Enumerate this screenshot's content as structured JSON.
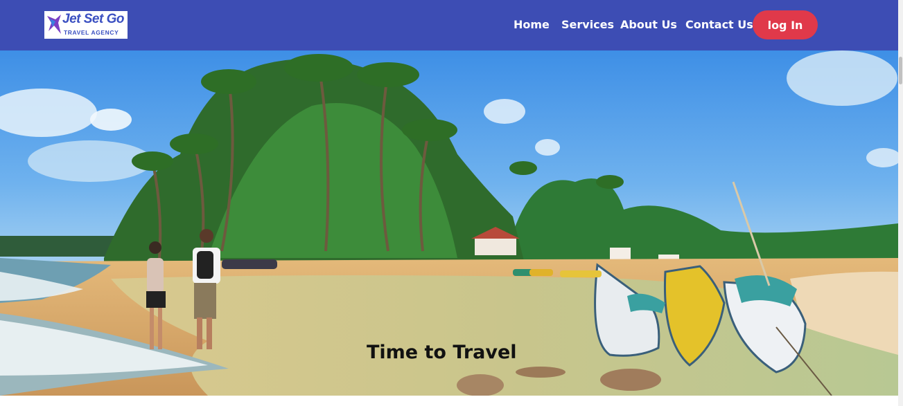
{
  "brand": {
    "name": "Jet Set Go",
    "tagline": "TRAVEL AGENCY"
  },
  "nav": {
    "links": [
      {
        "label": "Home"
      },
      {
        "label": "Services"
      },
      {
        "label": "About Us"
      },
      {
        "label": "Contact Us"
      }
    ],
    "login_label": "log In"
  },
  "hero": {
    "title": "Time to Travel",
    "image_icon": "beach-scene-image"
  },
  "colors": {
    "navbar": "#3d4db4",
    "login_button": "#e0394a",
    "nav_text": "#ffffff"
  }
}
